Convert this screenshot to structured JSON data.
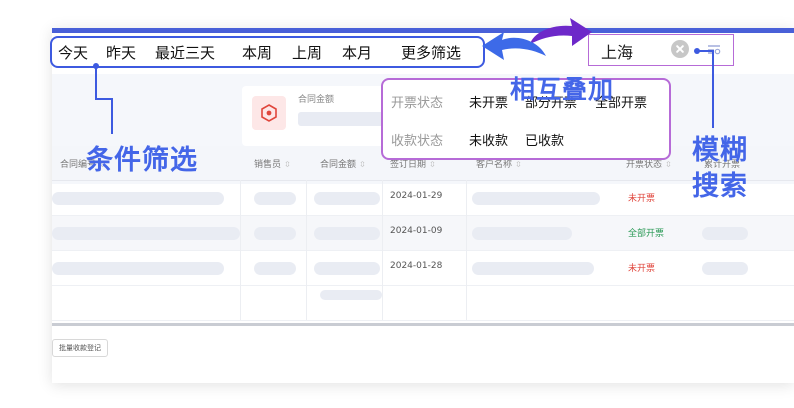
{
  "time_filters": [
    "今天",
    "昨天",
    "最近三天",
    "本周",
    "上周",
    "本月",
    "更多筛选"
  ],
  "search": {
    "value": "上海"
  },
  "status_filter": {
    "invoice_label": "开票状态",
    "invoice_options": [
      "未开票",
      "部分开票",
      "全部开票"
    ],
    "payment_label": "收款状态",
    "payment_options": [
      "未收款",
      "已收款"
    ]
  },
  "metric": {
    "label": "合同金额"
  },
  "table": {
    "headers": [
      "合同编号",
      "销售员",
      "合同金额",
      "签订日期",
      "客户名称",
      "开票状态",
      "累计开票"
    ],
    "rows": [
      {
        "date": "2024-01-29",
        "status": "未开票",
        "status_color": "#e0463c"
      },
      {
        "date": "2024-01-09",
        "status": "全部开票",
        "status_color": "#2b9a56"
      },
      {
        "date": "2024-01-28",
        "status": "未开票",
        "status_color": "#e0463c"
      }
    ]
  },
  "batch_button": "批量收款登记",
  "annotations": {
    "condition_filter": "条件筛选",
    "overlay": "相互叠加",
    "fuzzy_search_1": "模糊",
    "fuzzy_search_2": "搜索"
  },
  "colors": {
    "accent_blue": "#3d5ae0",
    "accent_purple": "#b66bd7",
    "annotation_blue": "#4466e8",
    "status_red": "#e0463c",
    "status_green": "#2b9a56"
  }
}
